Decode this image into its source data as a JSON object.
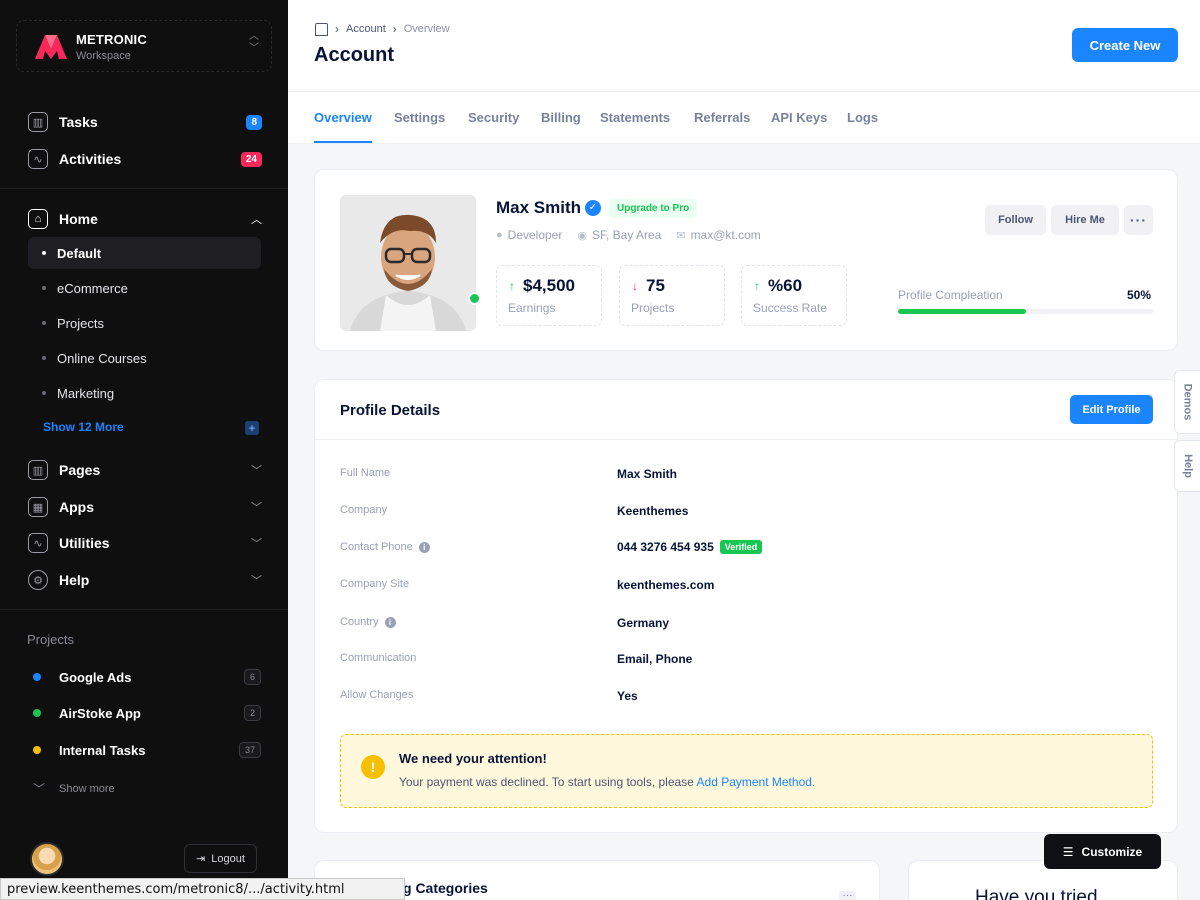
{
  "workspace": {
    "name": "METRONIC",
    "subtitle": "Workspace"
  },
  "sidebar": {
    "top_items": [
      {
        "label": "Tasks",
        "badge": "8"
      },
      {
        "label": "Activities",
        "badge": "24"
      }
    ],
    "home": {
      "label": "Home",
      "subitems": [
        "Default",
        "eCommerce",
        "Projects",
        "Online Courses",
        "Marketing"
      ],
      "show_more": "Show 12 More"
    },
    "groups": [
      "Pages",
      "Apps",
      "Utilities",
      "Help"
    ],
    "projects_header": "Projects",
    "projects": [
      {
        "label": "Google Ads",
        "count": "6",
        "color": "#1b84ff"
      },
      {
        "label": "AirStoke App",
        "count": "2",
        "color": "#17c653"
      },
      {
        "label": "Internal Tasks",
        "count": "37",
        "color": "#f6c000"
      }
    ],
    "show_more": "Show more",
    "logout": "Logout"
  },
  "header": {
    "breadcrumb": [
      "Account",
      "Overview"
    ],
    "title": "Account",
    "create_button": "Create New"
  },
  "tabs": [
    "Overview",
    "Settings",
    "Security",
    "Billing",
    "Statements",
    "Referrals",
    "API Keys",
    "Logs"
  ],
  "profile": {
    "name": "Max Smith",
    "upgrade": "Upgrade to Pro",
    "role": "Developer",
    "location": "SF, Bay Area",
    "email": "max@kt.com",
    "stats": [
      {
        "value": "$4,500",
        "label": "Earnings",
        "trend": "up"
      },
      {
        "value": "75",
        "label": "Projects",
        "trend": "down"
      },
      {
        "value": "%60",
        "label": "Success Rate",
        "trend": "up"
      }
    ],
    "follow": "Follow",
    "hire": "Hire Me",
    "completion_label": "Profile Compleation",
    "completion_value": "50%",
    "completion_fraction": 0.5
  },
  "details": {
    "title": "Profile Details",
    "edit_button": "Edit Profile",
    "rows": [
      {
        "label": "Full Name",
        "value": "Max Smith"
      },
      {
        "label": "Company",
        "value": "Keenthemes"
      },
      {
        "label": "Contact Phone",
        "value": "044 3276 454 935",
        "badge": "Verified"
      },
      {
        "label": "Company Site",
        "value": "keenthemes.com"
      },
      {
        "label": "Country",
        "value": "Germany"
      },
      {
        "label": "Communication",
        "value": "Email, Phone"
      },
      {
        "label": "Allow Changes",
        "value": "Yes"
      }
    ],
    "alert_title": "We need your attention!",
    "alert_text": "Your payment was declined. To start using tools, please",
    "alert_link": "Add Payment Method."
  },
  "bottom": {
    "card1_title": "g Categories",
    "card2_title": "Have you tried"
  },
  "side_tabs": [
    "Demos",
    "Help"
  ],
  "customize": "Customize",
  "status_url": "preview.keenthemes.com/metronic8/.../activity.html"
}
